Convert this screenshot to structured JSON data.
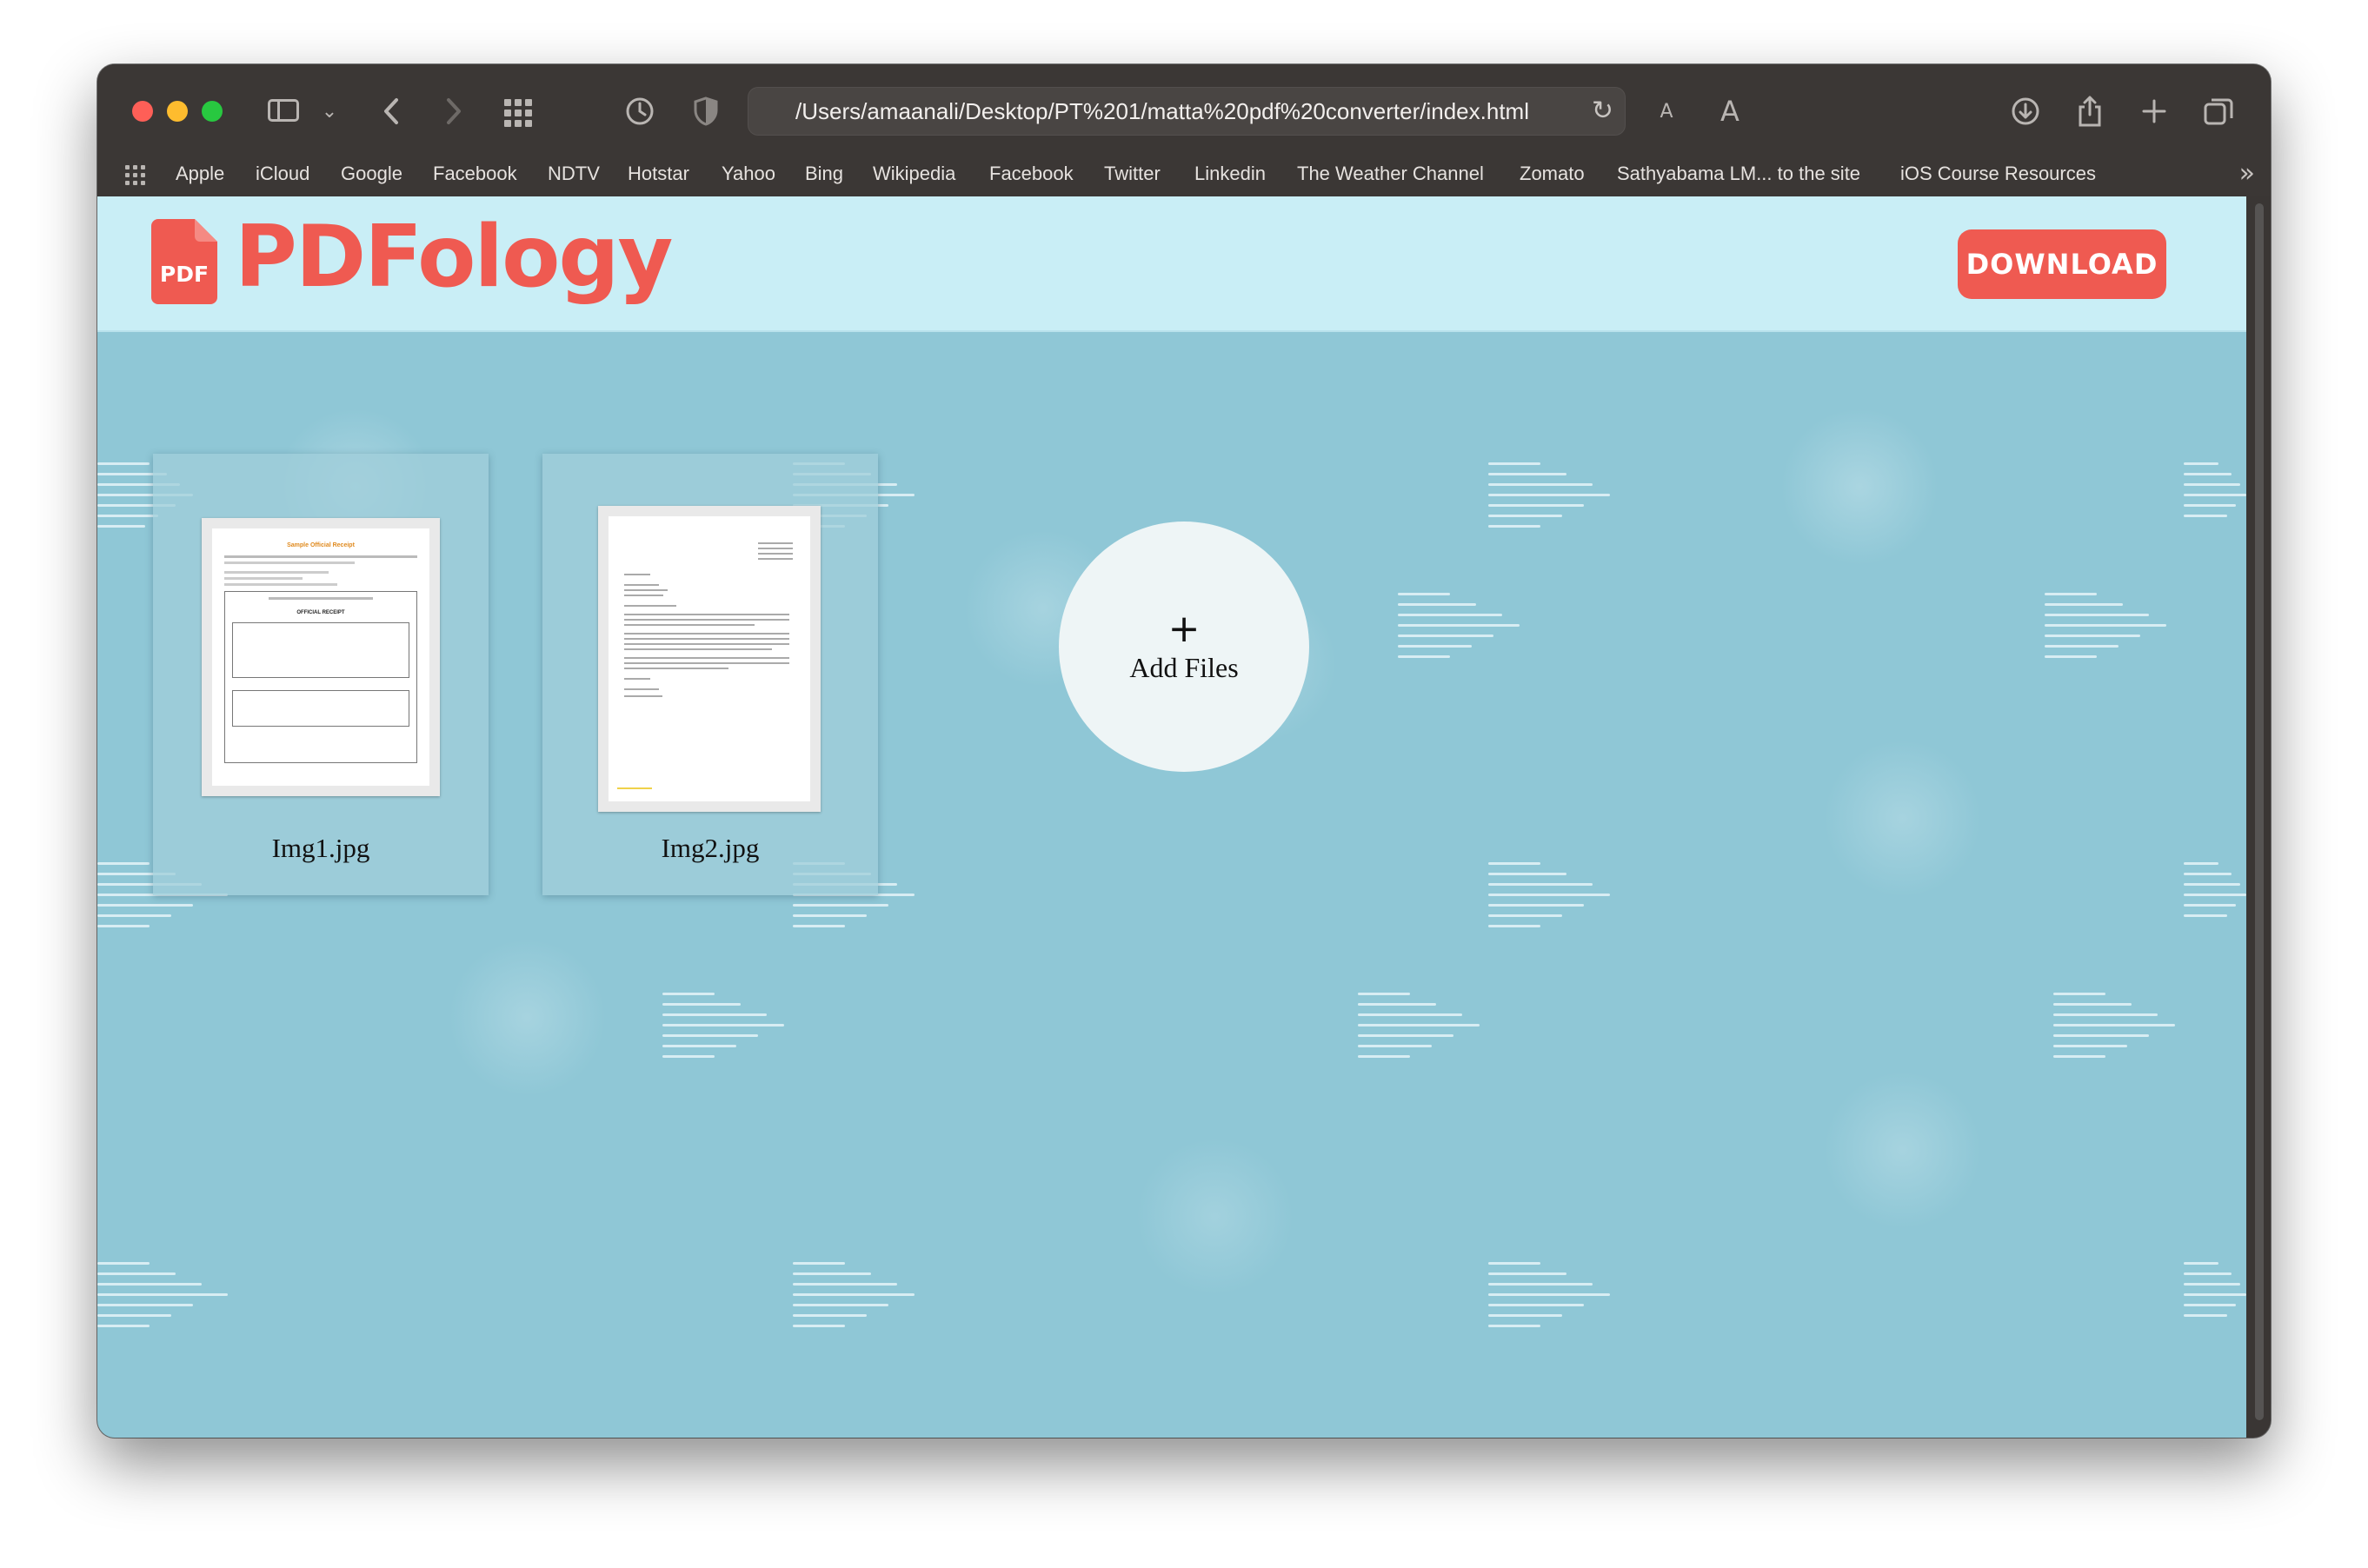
{
  "browser": {
    "url": "/Users/amaanali/Desktop/PT%201/matta%20pdf%20converter/index.html",
    "bookmarks": [
      "Apple",
      "iCloud",
      "Google",
      "Facebook",
      "NDTV",
      "Hotstar",
      "Yahoo",
      "Bing",
      "Wikipedia",
      "Facebook",
      "Twitter",
      "Linkedin",
      "The Weather Channel",
      "Zomato",
      "Sathyabama LM... to the site",
      "iOS Course Resources"
    ],
    "text_size_small": "A",
    "text_size_large": "A"
  },
  "header": {
    "logo_icon_text": "PDF",
    "logo_text": "PDFology",
    "download_label": "DOWNLOAD"
  },
  "files": [
    {
      "name": "Img1.jpg",
      "thumb_title": "Sample Official Receipt",
      "thumb_heading": "OFFICIAL RECEIPT"
    },
    {
      "name": "Img2.jpg"
    }
  ],
  "add_files": {
    "plus": "+",
    "label": "Add Files"
  },
  "colors": {
    "brand": "#ef5a51",
    "header_bg": "#c9eef6",
    "page_bg": "#8fc7d6",
    "chrome_bg": "#3b3735"
  }
}
